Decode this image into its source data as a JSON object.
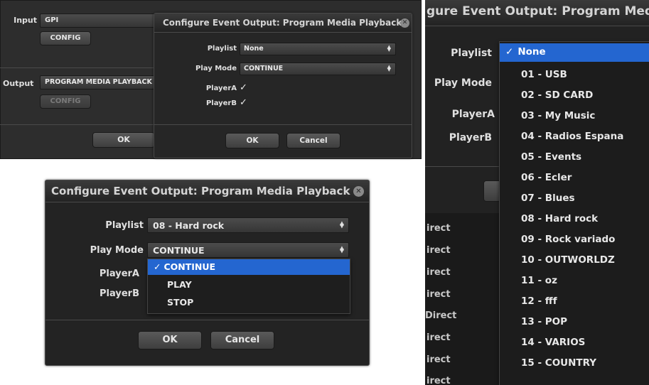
{
  "crop1": {
    "input_label": "Input",
    "input_value": "GPI",
    "config_label": "CONFIG",
    "output_label": "Output",
    "output_value": "PROGRAM MEDIA PLAYBACK",
    "config2_label": "CONFIG",
    "ok_label": "OK",
    "dialog": {
      "title": "Configure Event Output: Program Media Playback",
      "close_glyph": "✕",
      "playlist_label": "Playlist",
      "playlist_value": "None",
      "playmode_label": "Play Mode",
      "playmode_value": "CONTINUE",
      "playerA_label": "PlayerA",
      "playerA_check": "✓",
      "playerB_label": "PlayerB",
      "playerB_check": "✓",
      "ok_label": "OK",
      "cancel_label": "Cancel"
    }
  },
  "crop2": {
    "title": "Configure Event Output: Program Media Playback",
    "close_glyph": "✕",
    "playlist_label": "Playlist",
    "playlist_value": "08 - Hard rock",
    "playmode_label": "Play Mode",
    "playmode_value": "CONTINUE",
    "playerA_label": "PlayerA",
    "playerB_label": "PlayerB",
    "playmode_options": [
      "CONTINUE",
      "PLAY",
      "STOP"
    ],
    "selected_check": "✓",
    "ok_label": "OK",
    "cancel_label": "Cancel"
  },
  "crop3": {
    "title": "gure Event Output: Program Med",
    "playlist_label": "Playlist",
    "playmode_label": "Play Mode",
    "playerA_label": "PlayerA",
    "playerB_label": "PlayerB",
    "selected_check": "✓",
    "playlist_options": [
      "None",
      "01 - USB",
      "02 - SD CARD",
      "03 - My Music",
      "04 - Radios Espana",
      "05 - Events",
      "06 - Ecler",
      "07 - Blues",
      "08 - Hard rock",
      "09 - Rock variado",
      "10 - OUTWORLDZ",
      "11 - oz",
      "12 - fff",
      "13 - POP",
      "14 - VARIOS",
      "15 - COUNTRY"
    ],
    "background_rows": [
      "irect",
      "irect",
      "irect",
      "irect",
      "Direct",
      "irect",
      "irect",
      "irect"
    ]
  },
  "colors": {
    "selection": "#2466d0",
    "panel": "#262626"
  }
}
